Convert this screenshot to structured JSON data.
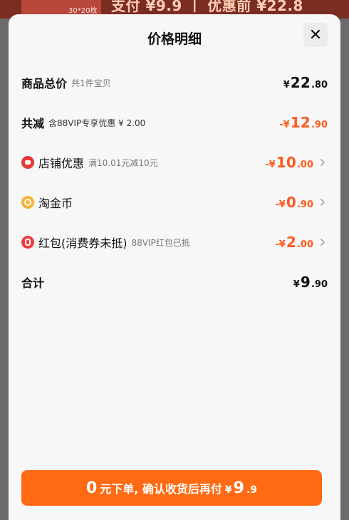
{
  "background": {
    "thumb_badge": "30*20枚",
    "pay_text": "支付 ¥9.9 丨 优惠前 ¥22.8"
  },
  "sheet": {
    "title": "价格明细",
    "close_icon": "close-icon"
  },
  "rows": [
    {
      "key": "total",
      "label": "商品总价",
      "note": "共1件宝贝",
      "amount_prefix": "¥",
      "amount_int": "22",
      "amount_dec": ".80",
      "negative": false,
      "has_chevron": false
    },
    {
      "key": "discount_total",
      "label": "共减",
      "note": "含88VIP专享优惠 ¥ 2.00",
      "amount_prefix": "-¥",
      "amount_int": "12",
      "amount_dec": ".90",
      "negative": true,
      "has_chevron": false
    },
    {
      "key": "store_discount",
      "icon": "store-icon",
      "label": "店铺优惠",
      "note": "满10.01元减10元",
      "amount_prefix": "-¥",
      "amount_int": "10",
      "amount_dec": ".00",
      "negative": true,
      "has_chevron": true
    },
    {
      "key": "taojin_coin",
      "icon": "coin-icon",
      "label": "淘金币",
      "note": "",
      "amount_prefix": "-¥",
      "amount_int": "0",
      "amount_dec": ".90",
      "negative": true,
      "has_chevron": true
    },
    {
      "key": "red_packet",
      "icon": "red-packet-icon",
      "label": "红包(消费券未抵)",
      "note": "88VIP红包已抵",
      "amount_prefix": "-¥",
      "amount_int": "2",
      "amount_dec": ".00",
      "negative": true,
      "has_chevron": true
    },
    {
      "key": "final",
      "label": "合计",
      "note": "",
      "amount_prefix": "¥",
      "amount_int": "9",
      "amount_dec": ".90",
      "negative": false,
      "has_chevron": false
    }
  ],
  "cta": {
    "zero": "0",
    "main": "元下单, 确认收货后再付",
    "yen": "¥",
    "int": "9",
    "dec": ".9"
  },
  "colors": {
    "accent": "#ff6a13",
    "discount": "#ff5a1f",
    "text": "#111111",
    "muted": "#777777",
    "sheet_bg": "#f7f7f7"
  }
}
